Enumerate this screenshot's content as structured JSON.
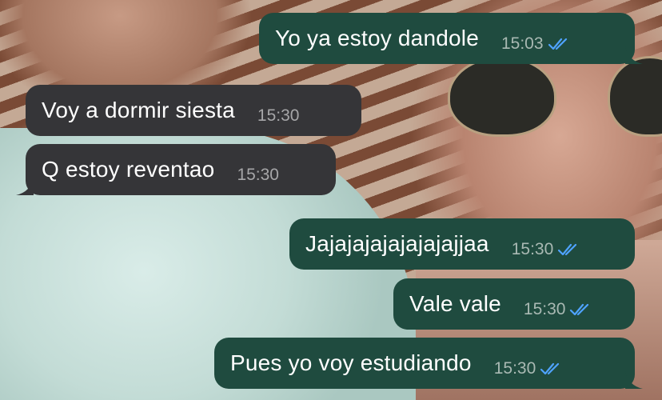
{
  "chat": {
    "messages": [
      {
        "direction": "out",
        "text": "Yo ya estoy dandole",
        "time": "15:03",
        "read": true
      },
      {
        "direction": "in",
        "text": "Voy a dormir siesta",
        "time": "15:30"
      },
      {
        "direction": "in",
        "text": "Q estoy reventao",
        "time": "15:30"
      },
      {
        "direction": "out",
        "text": "Jajajajajajajajajjaa",
        "time": "15:30",
        "read": true
      },
      {
        "direction": "out",
        "text": "Vale vale",
        "time": "15:30",
        "read": true
      },
      {
        "direction": "out",
        "text": "Pues yo voy estudiando",
        "time": "15:30",
        "read": true
      }
    ]
  },
  "colors": {
    "outgoing_bubble": "#1f4b3f",
    "incoming_bubble": "#353538",
    "read_ticks": "#4fa3ff"
  },
  "icons": {
    "read_receipt": "double-check-icon"
  }
}
